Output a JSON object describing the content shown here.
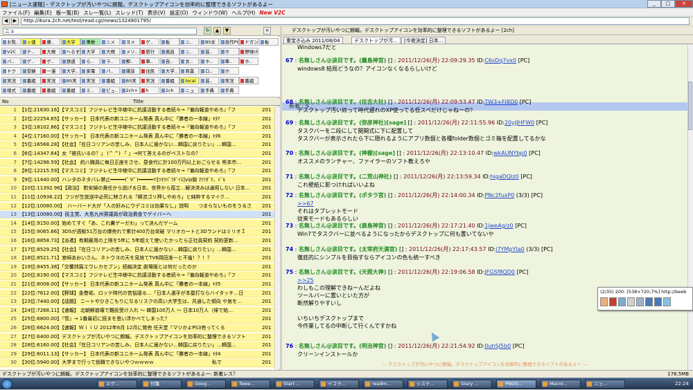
{
  "window": {
    "title": "[ニュース速報] - デスクトップが汚いやつに朗報。デスクトップアイコンを効率的に整理できるソフトがあるよー",
    "buttons": [
      "_",
      "□",
      "×"
    ]
  },
  "menu": [
    "ファイル(F)",
    "編集(E)",
    "板一覧(B)",
    "スレ一覧(L)",
    "スレッド(T)",
    "表示(V)",
    "設定(O)",
    "ウィンドウ(W)",
    "ヘルプ(H)",
    "New V2C"
  ],
  "address": "http://ikura.2ch.net/test/read.cgi/news/1324901795/",
  "left": {
    "category": "ニュ",
    "boards": [
      [
        "お覧..",
        "ッ速",
        "嫌..",
        "大学",
        "事故",
        "ニメ",
        "ヨメ",
        "ゲ..",
        "板",
        "ニ..",
        "BS女",
        "自作PC",
        "ドガン",
        "板"
      ],
      [
        "V2C",
        "テ..",
        "大規",
        "へるす",
        "大学",
        "大規",
        "メソ..",
        "旅行",
        "風呂",
        "ニ..",
        "芸..",
        "ホ",
        "野球ch"
      ],
      [
        "バ..",
        "ゲ..",
        "ゲ..",
        "鉄道",
        "ら..",
        "ラ..",
        "郵..",
        "車..",
        "自..",
        "女..",
        "ホ..",
        "車..",
        "ホ.."
      ],
      [
        "ドク",
        "受験",
        "一漫",
        "大学..",
        "家電",
        "バ..",
        "雑談",
        "住民",
        "大学..",
        "商業",
        "ロ..",
        "ホ"
      ],
      [
        "実況",
        "番組",
        "実況",
        "BS実",
        "実況",
        "番組",
        "BS実",
        "実況",
        "番組",
        "local",
        "芸..",
        "実況",
        "番組"
      ],
      [
        "様式",
        "番組",
        "番組",
        "番組",
        "ミ..",
        "ビュ..",
        "2ch+",
        "h",
        "2ch",
        "ニュ",
        "手典",
        "手典"
      ]
    ],
    "columns": {
      "no": "No",
      "title": "Title"
    },
    "threads": [
      {
        "n": "1",
        "t": "【1位:21630.16】【マスコミ】フジテレビ生中継中に抗議活動する者続々→『偏向報道やめろ』「フ",
        "y": "201"
      },
      {
        "n": "2",
        "t": "【2位:22254.65】【サッカー】 日本代表の新ユニホーム発表 真ん中に「勝者の一本線」ｷﾀ?",
        "y": "201"
      },
      {
        "n": "3",
        "t": "【3位:18102.86】【マスコミ】フジテレビ生中継中に抗議活動する者続々→『偏向報道やめろ』「フ",
        "y": "201"
      },
      {
        "n": "4",
        "t": "【4位:17160.00】【サッカー】 日本代表の新ユニホーム発表 真ん中に「勝者の一本線」ｷﾀ6",
        "y": "201"
      },
      {
        "n": "5",
        "t": "【5位:16568.28】【社会】「在日コリアンの苦しみ、日本人に届かない…韓国に戻りたい」…韓国…",
        "y": "201"
      },
      {
        "n": "6",
        "t": "【6位:14347.64】女「彼氏いるの？」 (^ ^) 「  」→何て答えるのがベストなの？",
        "y": "201"
      },
      {
        "n": "7",
        "t": "【7位:14298.59】【社会】 約八職員に毎日正座をさせ、昼食代に計100万円以上おごらせる 熊本市…",
        "y": "201"
      },
      {
        "n": "8",
        "t": "【8位:12215.59】【マスコミ】フジテレビ生中継中に抗議活動する者続々→『偏向報道やめろ』「フ",
        "y": "201"
      },
      {
        "n": "9",
        "t": "【9位:11440.00】ハンタのネタバレ禁止━━━━━(ﾟ∀ﾟ)━━━━━!![ﾂﾓﾘﾊﾟﾗﾀﾞｲｽ]vip版 ﾏﾂﾘﾀﾞﾅ、ﾄﾞﾙ",
        "y": "201"
      },
      {
        "n": "10",
        "t": "【10位:11392.96】【政治】 慰安婦の責任から逃げる日本、世界から孤立…解決済みは通用しない 日本…",
        "y": "201"
      },
      {
        "n": "11",
        "t": "【11位:10936.22】フジが生放送中必死に映される「韓流ゴリ押しやめろ」と純粋するマイク…",
        "y": "201"
      },
      {
        "n": "12",
        "t": "【12位:10080.00】　ハーバード大が「人の好みにウデコミは効果なし」説明　　つまらないものをうるさ",
        "y": "201"
      },
      {
        "n": "13",
        "t": "【13位:10080.00】民主党、大島九州男議員が政治資金でゲイバーへ",
        "y": "201"
      },
      {
        "n": "14",
        "t": "【14位:9150.00】始めてすぐ「あ、これ糞ゲーだわ」って決んだゲーム",
        "y": "201"
      },
      {
        "n": "15",
        "t": "【15位:9065.66】3DSが週販51万台の爆売れで累計400万台突破 マリオカートと3DランドはミリオＩ",
        "y": "201"
      },
      {
        "n": "16",
        "t": "【16位:8858.73】【派遣】有期雇用の上限を5年に 5年超えて使いたかったら正社員契約 契約更新…",
        "y": "201"
      },
      {
        "n": "17",
        "t": "【17位:8529.25】【社会】「在日コリアンの苦しみ、日本人に届かない…韓国に戻りたい」…韓国…",
        "y": "201"
      },
      {
        "n": "18",
        "t": "【18位:8521.71】宮崎あおいさん、ネトウヨの天を見捨てTV6岡田准一と不倫！？！？",
        "y": "201"
      },
      {
        "n": "19",
        "t": "【19位:8455.38】「交響詩篇エウレカセブン」続編決定 劇場版とは何だったのか",
        "y": "201"
      },
      {
        "n": "20",
        "t": "【20位:8190.00】【マスコミ】フジテレビ生中継中に抗議活動する者続々→『偏向報道やめろ』「フ",
        "y": "201"
      },
      {
        "n": "21",
        "t": "【21位:8008.00】【サッカー】 日本代表の新ユニホーム発表 真ん中に「勝者の一本線」ｷﾀ5",
        "y": "201"
      },
      {
        "n": "22",
        "t": "【22位:7612.00】【野球】金巻祐、ロッテ時代の苦悩語る…「日本人選手が本塁打ならハイタッチ…日",
        "y": "201"
      },
      {
        "n": "23",
        "t": "【23位:7440.00】【話題】 ニートやひきこもりになるリスクの高い大学生は、共通した傾向 や気を…",
        "y": "201"
      },
      {
        "n": "24",
        "t": "【24位:7268.11】【速報】 北朝鮮崩壊で難民受け入れ ～ 韓国100万人 ～ 日本10万人（帰で始…",
        "y": "201"
      },
      {
        "n": "25",
        "t": "【25位:6800.00】『雪』→ 1番最初に読まを思い浮かべてしまった？",
        "y": "201"
      },
      {
        "n": "26",
        "t": "【26位:6624.00】【速報】ＷｉｉＵ 2012年6月 12月に発売 任天堂『マジかよPS3売ってくる",
        "y": "201"
      },
      {
        "n": "27",
        "t": "【27位:6400.00】デスクトップが汚いやつに朗報。デスクトップアイコンを効率的に整理できるソフト",
        "y": "201"
      },
      {
        "n": "28",
        "t": "【28位:6160.00】【社会】「在日コリアンの苦しみ、日本人に届かない…韓国に戻りたい」…韓国…",
        "y": "201"
      },
      {
        "n": "29",
        "t": "【29位:6011.13】【サッカー】 日本代表の新ユニホーム発表 真ん中に「勝者の一本線」ｷﾀ4",
        "y": "201"
      },
      {
        "n": "30",
        "t": "【30位:5940.00】大学まで行って就職できないやつｗｗｗｗ　　　　　　　　　　　　私で",
        "y": "201"
      }
    ]
  },
  "right": {
    "thread_title": "デスクトップが汚いやつに朗報。デスクトップアイコンを効率的に整理できるソフトがあるよー [2ch]",
    "tabs": [
      "重宝き込み 2011/08/04",
      "デスクトップが汚...",
      "[今夜決定] 日本..."
    ],
    "top_lines": [
      "Windows7だと"
    ],
    "new_label": "新着 : 9",
    "posts": [
      {
        "num": "67",
        "name": "名無しさん@涙目です。(霧島神宮)",
        "date": "2011/12/26(月) 22:09:29.35",
        "id": "C6sDq7vx0",
        "pc": "[PC]",
        "body": [
          "windows8 結局どうなの？アイコンなくなるらしいけど"
        ]
      },
      {
        "num": "68",
        "name": "名無しさん@涙目です。(住吉大社)",
        "date": "2011/12/26(月) 22:09:53.47",
        "id": "TW3+FI8D0",
        "pc": "[PC]",
        "body": [
          "デスクトップ汚い奴って時代遅れのXP使ってる低スペだけじゃねーの？"
        ]
      },
      {
        "num": "69",
        "name": "名無しさん@涙目です。(弥彦神社)[sage]",
        "date": "2011/12/26(月) 22:11:55.96",
        "id": "20yJJHFW0",
        "pc": "[PC]",
        "body": [
          "タスクバーを二段にして閲開式に下に配置して",
          "タスクバーが表示されたら下に隠れるようにアプリ数個と各種folder数個とゴミ箱を配置してるかな"
        ]
      },
      {
        "num": "70",
        "name": "名無しさん@涙目です。(神棚)[sage]",
        "date": "2011/12/26(月) 22:13:10.47",
        "id": "wkAUNYbp0",
        "pc": "[PC]",
        "body": [
          "オススメのランチャー、ファイラーのソフト教えろや"
        ]
      },
      {
        "num": "71",
        "name": "名無しさん@涙目です。(二荒山神社)",
        "date": "2011/12/26(月) 22:13:59.34",
        "id": "higaDQIz0",
        "pc": "[PC]",
        "body": [
          "これ壁紙に影つければいいよね"
        ]
      },
      {
        "num": "72",
        "name": "名無しさん@涙目です。(ポタラ宮)",
        "date": "2011/12/26(月) 22:14:00.34",
        "id": "PNc2fuxP0",
        "pc": "(3/3) [PC]",
        "body": [
          ">>67",
          "それはタブレットモード",
          "従来モードもあるらしい"
        ]
      },
      {
        "num": "73",
        "name": "名無しさん@涙目です。(鹿島神宮)",
        "date": "2011/12/26(月) 22:17:21.40",
        "id": "1jweAg/z0",
        "pc": "[PC]",
        "body": [
          "Win7でタスクバーに並べるようになったからデスクトップに何も置いてないや"
        ]
      },
      {
        "num": "74",
        "name": "名無しさん@涙目です。(太宰府天満宮)",
        "date": "2011/12/26(月) 22:17:43.57",
        "id": "i7YMpYIa0",
        "pc": "(3/3) [PC]",
        "body": [
          "徹底的にシンプルを目指すならアイコンの色も統一すべき"
        ]
      },
      {
        "num": "75",
        "name": "名無しさん@涙目です。(天照大神)",
        "date": "2011/12/26(月) 22:19:06.58",
        "id": "JFGSf8QD0",
        "pc": "[PC]",
        "body": [
          ">>25",
          "わしもこの理解できねーんだよね",
          "ツールバーに置いといた方が",
          "断然解りやすいし",
          "",
          "いちいちデスクトップまで",
          "今作業してるの中断して行くんですかね"
        ]
      },
      {
        "num": "76",
        "name": "名無しさん@涙目です。(明治神宮)",
        "date": "2011/12/26(月) 22:21:54.92",
        "id": "0uhSJ5b0",
        "pc": "[PC]",
        "body": [
          "クリーンインストールか"
        ]
      }
    ],
    "footer_sep": "— デスクトップが汚いやつに朗報。デスクトップアイコンを効率的に整理できるソフトがあるよー —"
  },
  "popup": {
    "text": "(2/35) 200: [538×720,7%] http://beeb"
  },
  "status": {
    "text": "デスクトップが汚いやつに朗報。デスクトップアイコンを効率的に整理できるソフトがあるよー: 新着レス？",
    "size": "178.5MB"
  },
  "taskbar": {
    "items": [
      "エク...",
      "付箋",
      "Goog...",
      "Twee...",
      "Start ...",
      "イコラ...",
      "readm...",
      "システ...",
      "Glary ...",
      "PNGG...",
      "Macro...",
      "ニュ..."
    ],
    "clock": "22:24"
  }
}
